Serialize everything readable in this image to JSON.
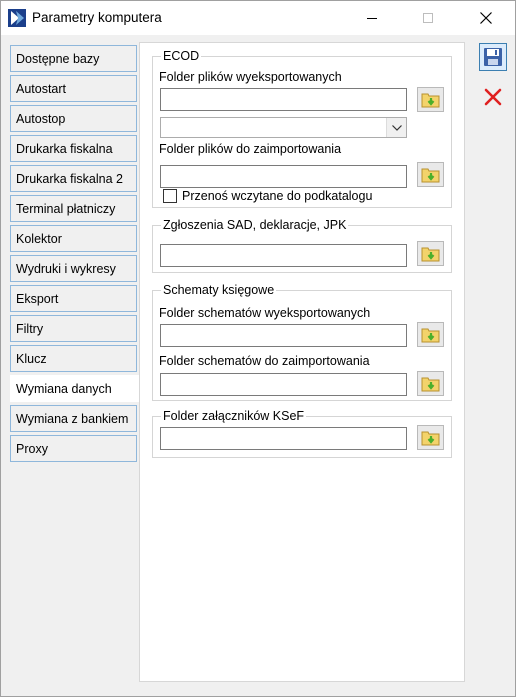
{
  "window": {
    "title": "Parametry komputera"
  },
  "nav": {
    "items": [
      {
        "label": "Dostępne bazy",
        "active": false
      },
      {
        "label": "Autostart",
        "active": false
      },
      {
        "label": "Autostop",
        "active": false
      },
      {
        "label": "Drukarka fiskalna",
        "active": false
      },
      {
        "label": "Drukarka fiskalna 2",
        "active": false
      },
      {
        "label": "Terminal płatniczy",
        "active": false
      },
      {
        "label": "Kolektor",
        "active": false
      },
      {
        "label": "Wydruki i wykresy",
        "active": false
      },
      {
        "label": "Eksport",
        "active": false
      },
      {
        "label": "Filtry",
        "active": false
      },
      {
        "label": "Klucz",
        "active": false
      },
      {
        "label": "Wymiana danych",
        "active": true
      },
      {
        "label": "Wymiana z bankiem",
        "active": false
      },
      {
        "label": "Proxy",
        "active": false
      }
    ]
  },
  "ecod": {
    "title": "ECOD",
    "export_label": "Folder plików wyeksportowanych",
    "export_value": "",
    "combo_value": "",
    "import_label": "Folder plików do zaimportowania",
    "import_value": "",
    "move_checkbox_label": "Przenoś wczytane do podkatalogu",
    "move_checked": false
  },
  "sad": {
    "title": "Zgłoszenia SAD, deklaracje, JPK",
    "value": ""
  },
  "schemas": {
    "title": "Schematy księgowe",
    "export_label": "Folder schematów wyeksportowanych",
    "export_value": "",
    "import_label": "Folder schematów do zaimportowania",
    "import_value": ""
  },
  "ksef": {
    "title": "Folder załączników KSeF",
    "value": ""
  },
  "colors": {
    "nav_border": "#8fb7db",
    "folder_green": "#4caf2b",
    "folder_yellow": "#f3d36b",
    "cancel_red": "#e02020",
    "save_blue": "#3c62a8"
  }
}
